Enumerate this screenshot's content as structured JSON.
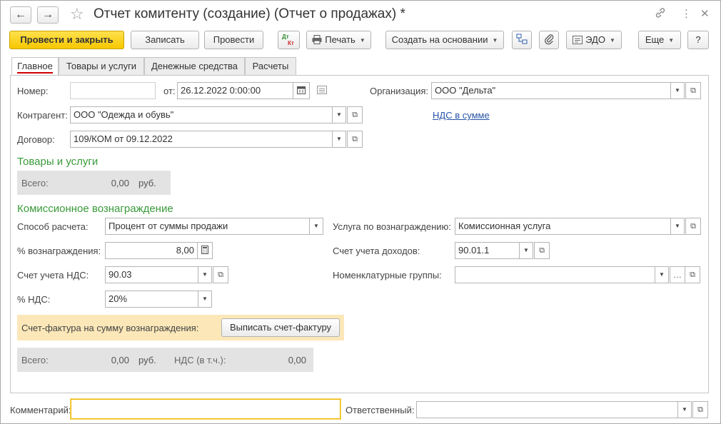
{
  "window": {
    "title": "Отчет комитенту (создание) (Отчет о продажах) *"
  },
  "toolbar": {
    "post_close": "Провести и закрыть",
    "save": "Записать",
    "post": "Провести",
    "dtkt_top": "Дт",
    "dtkt_bottom": "Кт",
    "print": "Печать",
    "create_based": "Создать на основании",
    "edo": "ЭДО",
    "more": "Еще",
    "help": "?"
  },
  "tabs": [
    {
      "label": "Главное"
    },
    {
      "label": "Товары и услуги"
    },
    {
      "label": "Денежные средства"
    },
    {
      "label": "Расчеты"
    }
  ],
  "header": {
    "number_label": "Номер:",
    "number_value": "",
    "date_label": "от:",
    "date_value": "26.12.2022  0:00:00",
    "org_label": "Организация:",
    "org_value": "ООО \"Дельта\"",
    "contractor_label": "Контрагент:",
    "contractor_value": "ООО \"Одежда и обувь\"",
    "vat_link": "НДС в сумме",
    "contract_label": "Договор:",
    "contract_value": "109/КОМ от 09.12.2022"
  },
  "goods": {
    "section_title": "Товары и услуги",
    "total_label": "Всего:",
    "total_value": "0,00",
    "currency": "руб."
  },
  "commission": {
    "section_title": "Комиссионное вознаграждение",
    "method_label": "Способ расчета:",
    "method_value": "Процент от суммы продажи",
    "percent_label": "% вознаграждения:",
    "percent_value": "8,00",
    "vat_account_label": "Счет учета НДС:",
    "vat_account_value": "90.03",
    "vat_percent_label": "% НДС:",
    "vat_percent_value": "20%",
    "service_label": "Услуга по вознаграждению:",
    "service_value": "Комиссионная услуга",
    "income_account_label": "Счет учета доходов:",
    "income_account_value": "90.01.1",
    "nomen_groups_label": "Номенклатурные группы:",
    "nomen_groups_value": "",
    "invoice_label": "Счет-фактура на сумму вознаграждения:",
    "invoice_button": "Выписать счет-фактуру",
    "total_label": "Всего:",
    "total_value": "0,00",
    "currency": "руб.",
    "vat_incl_label": "НДС (в т.ч.):",
    "vat_incl_value": "0,00"
  },
  "footer": {
    "comment_label": "Комментарий:",
    "comment_value": "",
    "responsible_label": "Ответственный:",
    "responsible_value": ""
  },
  "colors": {
    "primary_button": "#f7c700",
    "section_title": "#3a9a3a",
    "link": "#2754a8",
    "active_tab_underline": "#d10000",
    "comment_focus_border": "#f0b800",
    "invoice_bar": "#fbe7b8",
    "total_bar": "#e3e3e3"
  }
}
